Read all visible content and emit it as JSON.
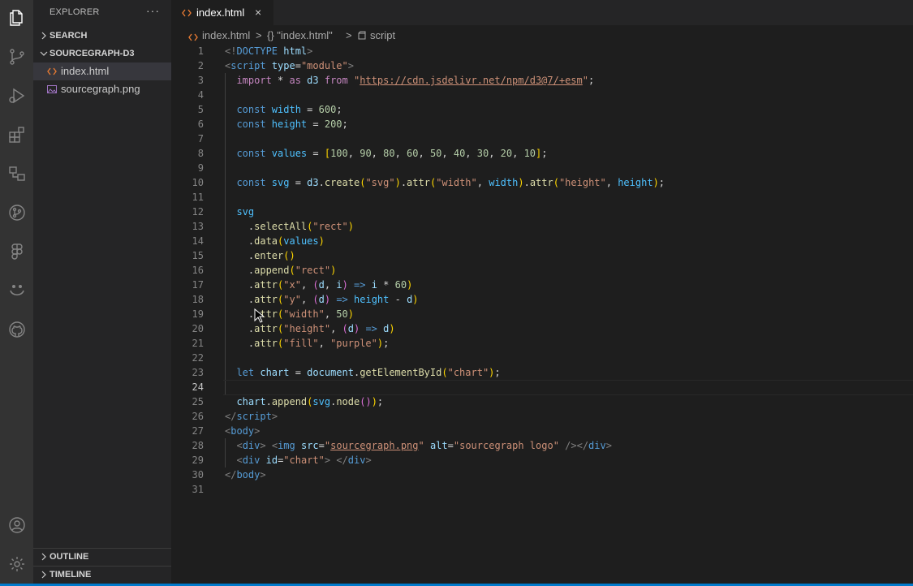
{
  "explorer": {
    "title": "EXPLORER",
    "more_label": "···",
    "search_label": "SEARCH",
    "folder_label": "SOURCEGRAPH-D3",
    "files": [
      {
        "name": "index.html",
        "icon": "html-file-icon",
        "active": true
      },
      {
        "name": "sourcegraph.png",
        "icon": "image-file-icon",
        "active": false
      }
    ],
    "outline_label": "OUTLINE",
    "timeline_label": "TIMELINE"
  },
  "tab": {
    "name": "index.html",
    "close": "×"
  },
  "breadcrumb": {
    "file": "index.html",
    "sep1": ">",
    "symbol": "{} \"index.html\"",
    "sep2": ">",
    "element": "script"
  },
  "editor": {
    "active_line": 24,
    "line_numbers": [
      "1",
      "2",
      "3",
      "4",
      "5",
      "6",
      "7",
      "8",
      "9",
      "10",
      "11",
      "12",
      "13",
      "14",
      "15",
      "16",
      "17",
      "18",
      "19",
      "20",
      "21",
      "22",
      "23",
      "24",
      "25",
      "26",
      "27",
      "28",
      "29",
      "30",
      "31"
    ],
    "lines": [
      [
        {
          "t": "<!",
          "c": "c-punc"
        },
        {
          "t": "DOCTYPE",
          "c": "c-tag"
        },
        {
          "t": " html",
          "c": "c-attr"
        },
        {
          "t": ">",
          "c": "c-punc"
        }
      ],
      [
        {
          "t": "<",
          "c": "c-punc"
        },
        {
          "t": "script",
          "c": "c-tag"
        },
        {
          "t": " type",
          "c": "c-attr"
        },
        {
          "t": "=",
          "c": "c-txt"
        },
        {
          "t": "\"module\"",
          "c": "c-str"
        },
        {
          "t": ">",
          "c": "c-punc"
        }
      ],
      [
        {
          "t": "  import",
          "c": "c-kw2"
        },
        {
          "t": " * ",
          "c": "c-txt"
        },
        {
          "t": "as",
          "c": "c-kw2"
        },
        {
          "t": " d3 ",
          "c": "c-var"
        },
        {
          "t": "from",
          "c": "c-kw2"
        },
        {
          "t": " \"",
          "c": "c-str"
        },
        {
          "t": "https://cdn.jsdelivr.net/npm/d3@7/+esm",
          "c": "c-link"
        },
        {
          "t": "\"",
          "c": "c-str"
        },
        {
          "t": ";",
          "c": "c-txt"
        }
      ],
      [],
      [
        {
          "t": "  const",
          "c": "c-kw"
        },
        {
          "t": " width",
          "c": "c-const"
        },
        {
          "t": " = ",
          "c": "c-txt"
        },
        {
          "t": "600",
          "c": "c-num"
        },
        {
          "t": ";",
          "c": "c-txt"
        }
      ],
      [
        {
          "t": "  const",
          "c": "c-kw"
        },
        {
          "t": " height",
          "c": "c-const"
        },
        {
          "t": " = ",
          "c": "c-txt"
        },
        {
          "t": "200",
          "c": "c-num"
        },
        {
          "t": ";",
          "c": "c-txt"
        }
      ],
      [],
      [
        {
          "t": "  const",
          "c": "c-kw"
        },
        {
          "t": " values",
          "c": "c-const"
        },
        {
          "t": " = ",
          "c": "c-txt"
        },
        {
          "t": "[",
          "c": "c-b1"
        },
        {
          "t": "100",
          "c": "c-num"
        },
        {
          "t": ", ",
          "c": "c-txt"
        },
        {
          "t": "90",
          "c": "c-num"
        },
        {
          "t": ", ",
          "c": "c-txt"
        },
        {
          "t": "80",
          "c": "c-num"
        },
        {
          "t": ", ",
          "c": "c-txt"
        },
        {
          "t": "60",
          "c": "c-num"
        },
        {
          "t": ", ",
          "c": "c-txt"
        },
        {
          "t": "50",
          "c": "c-num"
        },
        {
          "t": ", ",
          "c": "c-txt"
        },
        {
          "t": "40",
          "c": "c-num"
        },
        {
          "t": ", ",
          "c": "c-txt"
        },
        {
          "t": "30",
          "c": "c-num"
        },
        {
          "t": ", ",
          "c": "c-txt"
        },
        {
          "t": "20",
          "c": "c-num"
        },
        {
          "t": ", ",
          "c": "c-txt"
        },
        {
          "t": "10",
          "c": "c-num"
        },
        {
          "t": "]",
          "c": "c-b1"
        },
        {
          "t": ";",
          "c": "c-txt"
        }
      ],
      [],
      [
        {
          "t": "  const",
          "c": "c-kw"
        },
        {
          "t": " svg",
          "c": "c-const"
        },
        {
          "t": " = ",
          "c": "c-txt"
        },
        {
          "t": "d3",
          "c": "c-var"
        },
        {
          "t": ".",
          "c": "c-txt"
        },
        {
          "t": "create",
          "c": "c-fn"
        },
        {
          "t": "(",
          "c": "c-b1"
        },
        {
          "t": "\"svg\"",
          "c": "c-str"
        },
        {
          "t": ")",
          "c": "c-b1"
        },
        {
          "t": ".",
          "c": "c-txt"
        },
        {
          "t": "attr",
          "c": "c-fn"
        },
        {
          "t": "(",
          "c": "c-b1"
        },
        {
          "t": "\"width\"",
          "c": "c-str"
        },
        {
          "t": ", ",
          "c": "c-txt"
        },
        {
          "t": "width",
          "c": "c-const"
        },
        {
          "t": ")",
          "c": "c-b1"
        },
        {
          "t": ".",
          "c": "c-txt"
        },
        {
          "t": "attr",
          "c": "c-fn"
        },
        {
          "t": "(",
          "c": "c-b1"
        },
        {
          "t": "\"height\"",
          "c": "c-str"
        },
        {
          "t": ", ",
          "c": "c-txt"
        },
        {
          "t": "height",
          "c": "c-const"
        },
        {
          "t": ")",
          "c": "c-b1"
        },
        {
          "t": ";",
          "c": "c-txt"
        }
      ],
      [],
      [
        {
          "t": "  svg",
          "c": "c-const"
        }
      ],
      [
        {
          "t": "    .",
          "c": "c-txt"
        },
        {
          "t": "selectAll",
          "c": "c-fn"
        },
        {
          "t": "(",
          "c": "c-b1"
        },
        {
          "t": "\"rect\"",
          "c": "c-str"
        },
        {
          "t": ")",
          "c": "c-b1"
        }
      ],
      [
        {
          "t": "    .",
          "c": "c-txt"
        },
        {
          "t": "data",
          "c": "c-fn"
        },
        {
          "t": "(",
          "c": "c-b1"
        },
        {
          "t": "values",
          "c": "c-const"
        },
        {
          "t": ")",
          "c": "c-b1"
        }
      ],
      [
        {
          "t": "    .",
          "c": "c-txt"
        },
        {
          "t": "enter",
          "c": "c-fn"
        },
        {
          "t": "()",
          "c": "c-b1"
        }
      ],
      [
        {
          "t": "    .",
          "c": "c-txt"
        },
        {
          "t": "append",
          "c": "c-fn"
        },
        {
          "t": "(",
          "c": "c-b1"
        },
        {
          "t": "\"rect\"",
          "c": "c-str"
        },
        {
          "t": ")",
          "c": "c-b1"
        }
      ],
      [
        {
          "t": "    .",
          "c": "c-txt"
        },
        {
          "t": "attr",
          "c": "c-fn"
        },
        {
          "t": "(",
          "c": "c-b1"
        },
        {
          "t": "\"x\"",
          "c": "c-str"
        },
        {
          "t": ", ",
          "c": "c-txt"
        },
        {
          "t": "(",
          "c": "c-b2"
        },
        {
          "t": "d",
          "c": "c-var"
        },
        {
          "t": ", ",
          "c": "c-txt"
        },
        {
          "t": "i",
          "c": "c-var"
        },
        {
          "t": ")",
          "c": "c-b2"
        },
        {
          "t": " => ",
          "c": "c-kw"
        },
        {
          "t": "i",
          "c": "c-var"
        },
        {
          "t": " * ",
          "c": "c-txt"
        },
        {
          "t": "60",
          "c": "c-num"
        },
        {
          "t": ")",
          "c": "c-b1"
        }
      ],
      [
        {
          "t": "    .",
          "c": "c-txt"
        },
        {
          "t": "attr",
          "c": "c-fn"
        },
        {
          "t": "(",
          "c": "c-b1"
        },
        {
          "t": "\"y\"",
          "c": "c-str"
        },
        {
          "t": ", ",
          "c": "c-txt"
        },
        {
          "t": "(",
          "c": "c-b2"
        },
        {
          "t": "d",
          "c": "c-var"
        },
        {
          "t": ")",
          "c": "c-b2"
        },
        {
          "t": " => ",
          "c": "c-kw"
        },
        {
          "t": "height",
          "c": "c-const"
        },
        {
          "t": " - ",
          "c": "c-txt"
        },
        {
          "t": "d",
          "c": "c-var"
        },
        {
          "t": ")",
          "c": "c-b1"
        }
      ],
      [
        {
          "t": "    .",
          "c": "c-txt"
        },
        {
          "t": "attr",
          "c": "c-fn"
        },
        {
          "t": "(",
          "c": "c-b1"
        },
        {
          "t": "\"width\"",
          "c": "c-str"
        },
        {
          "t": ", ",
          "c": "c-txt"
        },
        {
          "t": "50",
          "c": "c-num"
        },
        {
          "t": ")",
          "c": "c-b1"
        }
      ],
      [
        {
          "t": "    .",
          "c": "c-txt"
        },
        {
          "t": "attr",
          "c": "c-fn"
        },
        {
          "t": "(",
          "c": "c-b1"
        },
        {
          "t": "\"height\"",
          "c": "c-str"
        },
        {
          "t": ", ",
          "c": "c-txt"
        },
        {
          "t": "(",
          "c": "c-b2"
        },
        {
          "t": "d",
          "c": "c-var"
        },
        {
          "t": ")",
          "c": "c-b2"
        },
        {
          "t": " => ",
          "c": "c-kw"
        },
        {
          "t": "d",
          "c": "c-var"
        },
        {
          "t": ")",
          "c": "c-b1"
        }
      ],
      [
        {
          "t": "    .",
          "c": "c-txt"
        },
        {
          "t": "attr",
          "c": "c-fn"
        },
        {
          "t": "(",
          "c": "c-b1"
        },
        {
          "t": "\"fill\"",
          "c": "c-str"
        },
        {
          "t": ", ",
          "c": "c-txt"
        },
        {
          "t": "\"purple\"",
          "c": "c-str"
        },
        {
          "t": ")",
          "c": "c-b1"
        },
        {
          "t": ";",
          "c": "c-txt"
        }
      ],
      [],
      [
        {
          "t": "  let",
          "c": "c-kw"
        },
        {
          "t": " chart",
          "c": "c-var"
        },
        {
          "t": " = ",
          "c": "c-txt"
        },
        {
          "t": "document",
          "c": "c-var"
        },
        {
          "t": ".",
          "c": "c-txt"
        },
        {
          "t": "getElementById",
          "c": "c-fn"
        },
        {
          "t": "(",
          "c": "c-b1"
        },
        {
          "t": "\"chart\"",
          "c": "c-str"
        },
        {
          "t": ")",
          "c": "c-b1"
        },
        {
          "t": ";",
          "c": "c-txt"
        }
      ],
      [],
      [
        {
          "t": "  chart",
          "c": "c-var"
        },
        {
          "t": ".",
          "c": "c-txt"
        },
        {
          "t": "append",
          "c": "c-fn"
        },
        {
          "t": "(",
          "c": "c-b1"
        },
        {
          "t": "svg",
          "c": "c-const"
        },
        {
          "t": ".",
          "c": "c-txt"
        },
        {
          "t": "node",
          "c": "c-fn"
        },
        {
          "t": "()",
          "c": "c-b2"
        },
        {
          "t": ")",
          "c": "c-b1"
        },
        {
          "t": ";",
          "c": "c-txt"
        }
      ],
      [
        {
          "t": "</",
          "c": "c-punc"
        },
        {
          "t": "script",
          "c": "c-tag"
        },
        {
          "t": ">",
          "c": "c-punc"
        }
      ],
      [
        {
          "t": "<",
          "c": "c-punc"
        },
        {
          "t": "body",
          "c": "c-tag"
        },
        {
          "t": ">",
          "c": "c-punc"
        }
      ],
      [
        {
          "t": "  <",
          "c": "c-punc"
        },
        {
          "t": "div",
          "c": "c-tag"
        },
        {
          "t": ">",
          "c": "c-punc"
        },
        {
          "t": " <",
          "c": "c-punc"
        },
        {
          "t": "img",
          "c": "c-tag"
        },
        {
          "t": " src",
          "c": "c-attr"
        },
        {
          "t": "=",
          "c": "c-txt"
        },
        {
          "t": "\"",
          "c": "c-str"
        },
        {
          "t": "sourcegraph.png",
          "c": "c-link"
        },
        {
          "t": "\"",
          "c": "c-str"
        },
        {
          "t": " alt",
          "c": "c-attr"
        },
        {
          "t": "=",
          "c": "c-txt"
        },
        {
          "t": "\"sourcegraph logo\"",
          "c": "c-str"
        },
        {
          "t": " /></",
          "c": "c-punc"
        },
        {
          "t": "div",
          "c": "c-tag"
        },
        {
          "t": ">",
          "c": "c-punc"
        }
      ],
      [
        {
          "t": "  <",
          "c": "c-punc"
        },
        {
          "t": "div",
          "c": "c-tag"
        },
        {
          "t": " id",
          "c": "c-attr"
        },
        {
          "t": "=",
          "c": "c-txt"
        },
        {
          "t": "\"chart\"",
          "c": "c-str"
        },
        {
          "t": "> </",
          "c": "c-punc"
        },
        {
          "t": "div",
          "c": "c-tag"
        },
        {
          "t": ">",
          "c": "c-punc"
        }
      ],
      [
        {
          "t": "</",
          "c": "c-punc"
        },
        {
          "t": "body",
          "c": "c-tag"
        },
        {
          "t": ">",
          "c": "c-punc"
        }
      ],
      []
    ]
  },
  "colors": {
    "activity_bar": "#333333",
    "sidebar": "#252526",
    "editor": "#1e1e1e",
    "status_bar": "#007acc",
    "html_icon": "#e37933",
    "image_icon": "#a074c4"
  }
}
